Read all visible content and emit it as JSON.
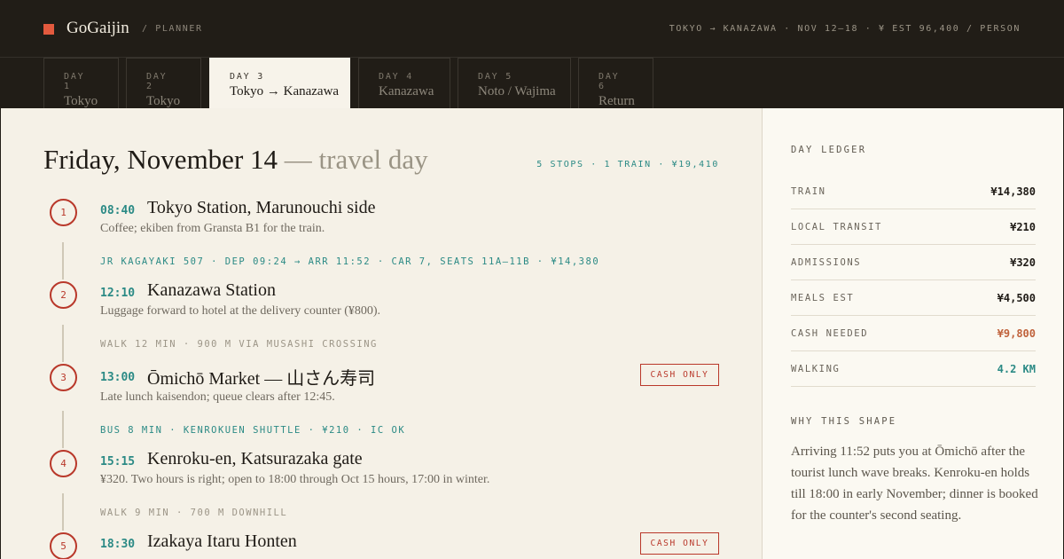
{
  "header": {
    "brand": "GoGaijin",
    "section": "/ PLANNER",
    "trip_summary": "TOKYO → KANAZAWA · NOV 12–18 · ¥ EST 96,400 / PERSON"
  },
  "tabs": [
    {
      "day": "DAY 1",
      "city": "Tokyo"
    },
    {
      "day": "DAY 2",
      "city": "Tokyo"
    },
    {
      "day": "DAY 3",
      "city": "Tokyo → Kanazawa"
    },
    {
      "day": "DAY 4",
      "city": "Kanazawa"
    },
    {
      "day": "DAY 5",
      "city": "Noto / Wajima"
    },
    {
      "day": "DAY 6",
      "city": "Return"
    }
  ],
  "active_tab": "DAY 3",
  "day": {
    "title": "Friday, November 14",
    "subtitle": "— travel day",
    "stats": "5 STOPS · 1 TRAIN · ¥19,410"
  },
  "stops": [
    {
      "num": "1",
      "time": "08:40",
      "name": "Tokyo Station, Marunouchi side",
      "note": "Coffee; ekiben from Gransta B1 for the train."
    },
    {
      "num": "2",
      "time": "12:10",
      "name": "Kanazawa Station",
      "note": "Luggage forward to hotel at the delivery counter (¥800)."
    },
    {
      "num": "3",
      "time": "13:00",
      "name": "Ōmichō Market — 山さん寿司",
      "note": "Late lunch kaisendon; queue clears after 12:45.",
      "badge": "CASH ONLY"
    },
    {
      "num": "4",
      "time": "15:15",
      "name": "Kenroku-en, Katsurazaka gate",
      "note": "¥320. Two hours is right; open to 18:00 through Oct 15 hours, 17:00 in winter."
    },
    {
      "num": "5",
      "time": "18:30",
      "name": "Izakaya Itaru Honten",
      "note": "",
      "badge": "CASH ONLY"
    }
  ],
  "legs": [
    {
      "kind": "train",
      "text": "JR KAGAYAKI 507 · DEP 09:24 → ARR 11:52 · CAR 7, SEATS 11A–11B · ¥14,380"
    },
    {
      "kind": "walk",
      "text": "WALK 12 MIN · 900 M VIA MUSASHI CROSSING"
    },
    {
      "kind": "bus",
      "text": "BUS 8 MIN · KENROKUEN SHUTTLE · ¥210 · IC OK"
    },
    {
      "kind": "walk",
      "text": "WALK 9 MIN · 700 M DOWNHILL"
    }
  ],
  "ledger": {
    "title": "DAY LEDGER",
    "rows": [
      {
        "label": "TRAIN",
        "value": "¥14,380"
      },
      {
        "label": "LOCAL TRANSIT",
        "value": "¥210"
      },
      {
        "label": "ADMISSIONS",
        "value": "¥320"
      },
      {
        "label": "MEALS EST",
        "value": "¥4,500"
      },
      {
        "label": "CASH NEEDED",
        "value": "¥9,800"
      },
      {
        "label": "WALKING",
        "value": "4.2 KM"
      }
    ]
  },
  "why": {
    "title": "WHY THIS SHAPE",
    "text": "Arriving 11:52 puts you at Ōmichō after the tourist lunch wave breaks. Kenroku-en holds till 18:00 in early November; dinner is booked for the counter's second seating."
  },
  "colors": {
    "accent_red": "#b9382a",
    "logo_red": "#e35a3e",
    "teal": "#2b8a85",
    "cash_warn": "#c0623b",
    "dark_bg": "#211d17",
    "paper": "#f5f1e7"
  }
}
